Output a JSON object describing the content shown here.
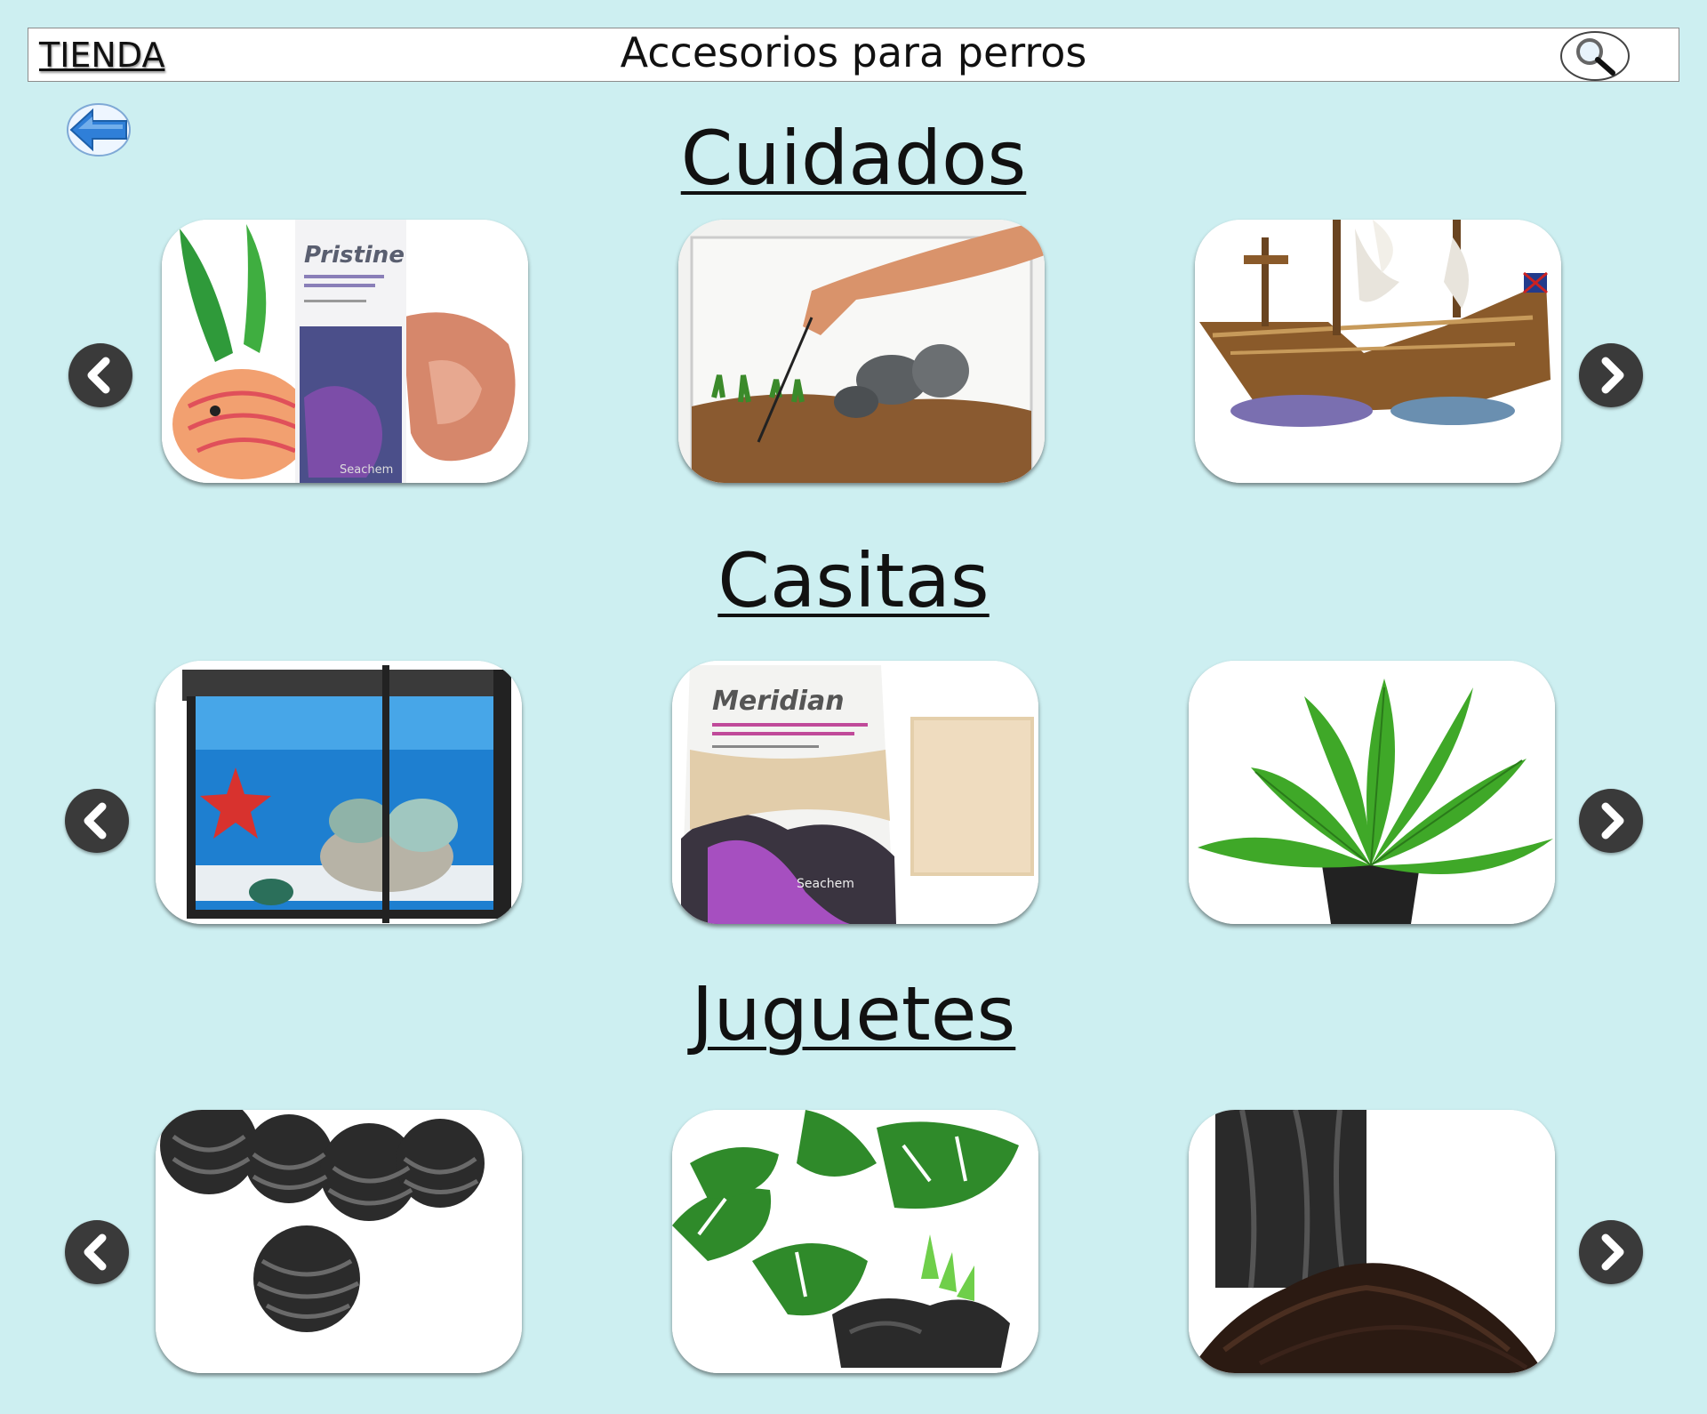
{
  "header": {
    "store_label": "TIENDA",
    "title": "Accesorios para perros",
    "search_icon": "search-icon"
  },
  "back_icon": "back-arrow-icon",
  "sections": [
    {
      "title": "Cuidados",
      "products": [
        {
          "icon": "pristine-bottle-image",
          "brand_text": "Pristine",
          "maker_text": "Seachem"
        },
        {
          "icon": "aquarium-planting-image"
        },
        {
          "icon": "shipwreck-ornament-image"
        }
      ]
    },
    {
      "title": "Casitas",
      "products": [
        {
          "icon": "aquarium-tank-image"
        },
        {
          "icon": "meridian-substrate-bag-image",
          "brand_text": "Meridian",
          "maker_text": "Seachem"
        },
        {
          "icon": "aquatic-plant-pot-image"
        }
      ]
    },
    {
      "title": "Juguetes",
      "products": [
        {
          "icon": "bio-balls-image"
        },
        {
          "icon": "artificial-plants-decor-image"
        },
        {
          "icon": "soil-substrate-image"
        }
      ]
    }
  ],
  "colors": {
    "background": "#cdeff1",
    "nav_button": "#3a3a3a",
    "back_arrow": "#2f7fd8"
  }
}
